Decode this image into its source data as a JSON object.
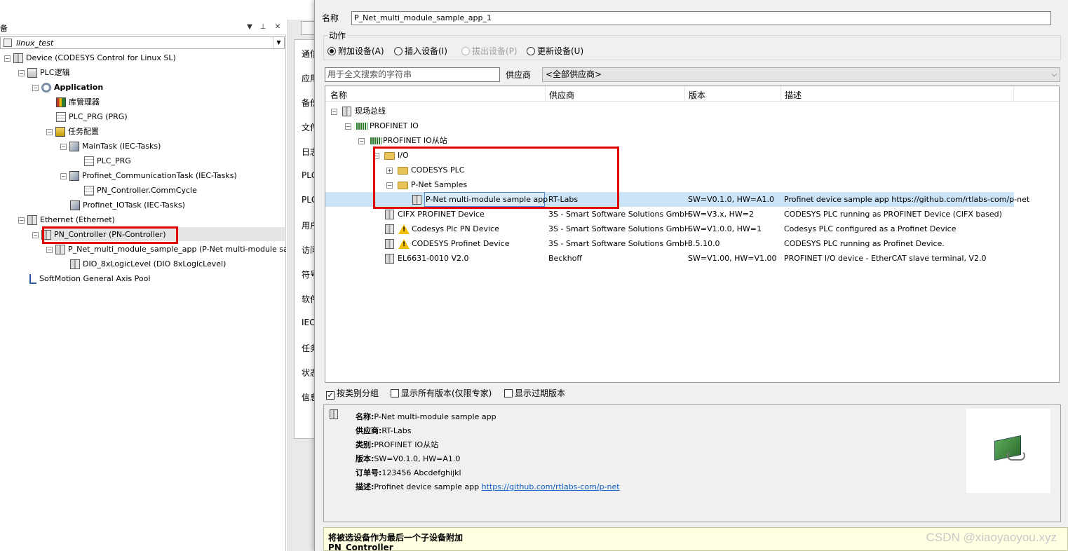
{
  "left_pane": {
    "title": "备",
    "project_name": "linux_test",
    "tree": [
      {
        "label": "Device (CODESYS Control for Linux SL)",
        "bold": false
      },
      {
        "label": "PLC逻辑",
        "bold": false
      },
      {
        "label": "Application",
        "bold": true
      },
      {
        "label": "库管理器",
        "bold": false
      },
      {
        "label": "PLC_PRG (PRG)",
        "bold": false
      },
      {
        "label": "任务配置",
        "bold": false
      },
      {
        "label": "MainTask (IEC-Tasks)",
        "bold": false
      },
      {
        "label": "PLC_PRG",
        "bold": false
      },
      {
        "label": "Profinet_CommunicationTask (IEC-Tasks)",
        "bold": false
      },
      {
        "label": "PN_Controller.CommCycle",
        "bold": false
      },
      {
        "label": "Profinet_IOTask (IEC-Tasks)",
        "bold": false
      },
      {
        "label": "Ethernet (Ethernet)",
        "bold": false
      },
      {
        "label": "PN_Controller (PN-Controller)",
        "bold": false
      },
      {
        "label": "P_Net_multi_module_sample_app (P-Net multi-module sample ap",
        "bold": false
      },
      {
        "label": "DIO_8xLogicLevel (DIO 8xLogicLevel)",
        "bold": false
      },
      {
        "label": "SoftMotion General Axis Pool",
        "bold": false
      }
    ]
  },
  "middle_tabs": [
    "通信",
    "应用",
    "备份",
    "文件",
    "日志",
    "PLC",
    "PLC",
    "用户",
    "访问",
    "符号",
    "软件",
    "IEC",
    "任务",
    "状态",
    "信息"
  ],
  "dialog": {
    "name_label": "名称",
    "name_value": "P_Net_multi_module_sample_app_1",
    "action_title": "动作",
    "actions": [
      {
        "label": "附加设备(A)",
        "selected": true,
        "enabled": true
      },
      {
        "label": "插入设备(I)",
        "selected": false,
        "enabled": true
      },
      {
        "label": "拔出设备(P)",
        "selected": false,
        "enabled": false
      },
      {
        "label": "更新设备(U)",
        "selected": false,
        "enabled": true
      }
    ],
    "search_placeholder": "用于全文搜索的字符串",
    "vendor_label": "供应商",
    "vendor_value": "<全部供应商>",
    "columns": [
      "名称",
      "供应商",
      "版本",
      "描述"
    ],
    "rows": [
      {
        "name": "现场总线",
        "vendor": "",
        "version": "",
        "desc": ""
      },
      {
        "name": "PROFINET IO",
        "vendor": "",
        "version": "",
        "desc": ""
      },
      {
        "name": "PROFINET IO从站",
        "vendor": "",
        "version": "",
        "desc": ""
      },
      {
        "name": "I/O",
        "vendor": "",
        "version": "",
        "desc": ""
      },
      {
        "name": "CODESYS PLC",
        "vendor": "",
        "version": "",
        "desc": ""
      },
      {
        "name": "P-Net Samples",
        "vendor": "",
        "version": "",
        "desc": ""
      },
      {
        "name": "P-Net multi-module sample app",
        "vendor": "RT-Labs",
        "version": "SW=V0.1.0, HW=A1.0",
        "desc": "Profinet device sample app https://github.com/rtlabs-com/p-net"
      },
      {
        "name": "CIFX PROFINET Device",
        "vendor": "3S - Smart Software Solutions GmbH",
        "version": "SW=V3.x, HW=2",
        "desc": "CODESYS PLC running as PROFINET Device (CIFX based)"
      },
      {
        "name": "Codesys Plc PN Device",
        "vendor": "3S - Smart Software Solutions GmbH",
        "version": "SW=V1.0.0, HW=1",
        "desc": "Codesys PLC configured as a Profinet Device"
      },
      {
        "name": "CODESYS Profinet Device",
        "vendor": "3S - Smart Software Solutions GmbH",
        "version": "3.5.10.0",
        "desc": "CODESYS PLC running as Profinet Device."
      },
      {
        "name": "EL6631-0010 V2.0",
        "vendor": "Beckhoff",
        "version": "SW=V1.00, HW=V1.00",
        "desc": "PROFINET I/O device - EtherCAT slave terminal, V2.0"
      }
    ],
    "options": [
      {
        "label": "按类别分组",
        "checked": true
      },
      {
        "label": "显示所有版本(仅限专家)",
        "checked": false
      },
      {
        "label": "显示过期版本",
        "checked": false
      }
    ],
    "info": {
      "name_key": "名称:",
      "name_val": "P-Net multi-module sample app",
      "vendor_key": "供应商:",
      "vendor_val": "RT-Labs",
      "category_key": "类别:",
      "category_val": "PROFINET IO从站",
      "version_key": "版本:",
      "version_val": "SW=V0.1.0, HW=A1.0",
      "order_key": "订单号:",
      "order_val": "123456 Abcdefghijkl",
      "desc_key": "描述:",
      "desc_val": "Profinet device sample app ",
      "desc_link": "https://github.com/rtlabs-com/p-net"
    },
    "bottom_msg_line1": "将被选设备作为最后一个子设备附加",
    "bottom_msg_line2": "PN_Controller"
  },
  "watermark": "CSDN @xiaoyaoyou.xyz",
  "colors": {
    "highlight_red": "#e00000",
    "selected_row": "#cce4f7",
    "link": "#0b5fc5"
  }
}
